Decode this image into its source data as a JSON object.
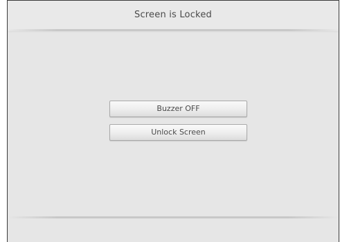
{
  "header": {
    "title": "Screen is Locked"
  },
  "actions": {
    "buzzer_label": "Buzzer OFF",
    "unlock_label": "Unlock Screen"
  },
  "colors": {
    "background": "#e6e6e6",
    "text": "#4a4a4a",
    "border": "#3a3a3a"
  }
}
